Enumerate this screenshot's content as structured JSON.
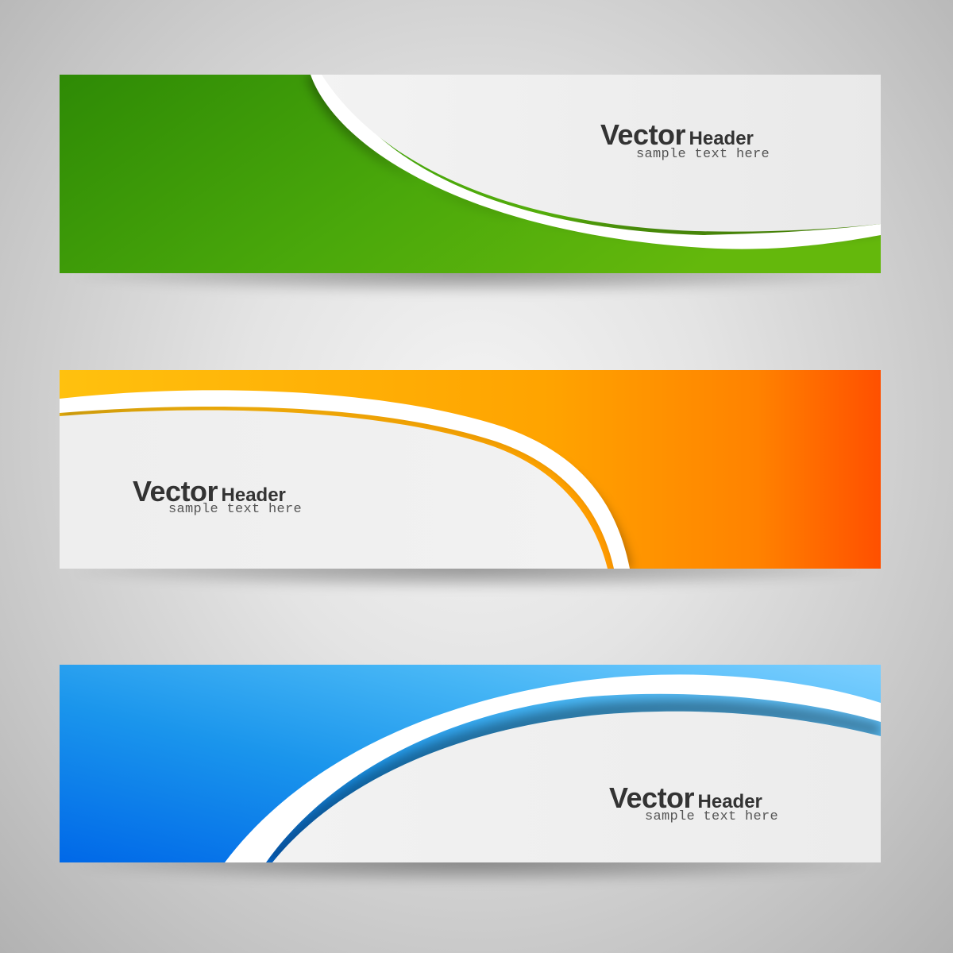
{
  "banners": [
    {
      "id": "green",
      "title_main": "Vector",
      "title_rest": "Header",
      "subtitle": "sample text here",
      "colors": [
        "#2e8a05",
        "#4aa80b",
        "#64b80c"
      ]
    },
    {
      "id": "orange",
      "title_main": "Vector",
      "title_rest": "Header",
      "subtitle": "sample text here",
      "colors": [
        "#ffc10e",
        "#ffa300",
        "#ff5000"
      ]
    },
    {
      "id": "blue",
      "title_main": "Vector",
      "title_rest": "Header",
      "subtitle": "sample text here",
      "colors": [
        "#0068e8",
        "#2aa0ee",
        "#7ccfff"
      ]
    }
  ],
  "panel_color": "#ededed"
}
